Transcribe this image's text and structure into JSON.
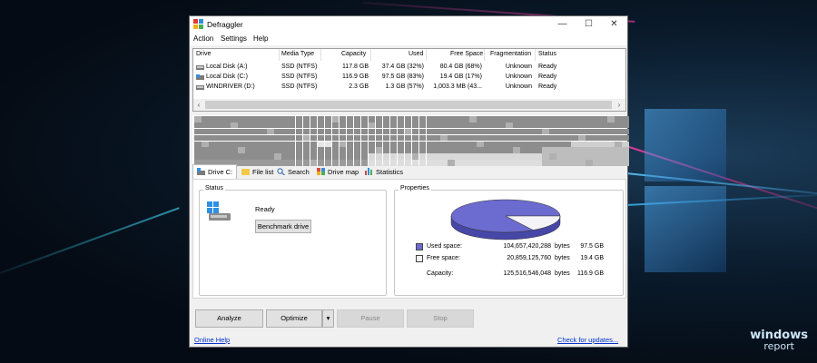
{
  "window": {
    "title": "Defraggler",
    "minimize": "—",
    "maximize": "☐",
    "close": "✕"
  },
  "menu": [
    "Action",
    "Settings",
    "Help"
  ],
  "drive_list": {
    "columns": [
      "Drive",
      "Media Type",
      "Capacity",
      "Used",
      "Free Space",
      "Fragmentation",
      "Status"
    ],
    "rows": [
      {
        "drive": "Local Disk (A:)",
        "media": "SSD (NTFS)",
        "capacity": "117.8 GB",
        "used": "37.4 GB (32%)",
        "free": "80.4 GB (68%)",
        "frag": "Unknown",
        "status": "Ready"
      },
      {
        "drive": "Local Disk (C:)",
        "media": "SSD (NTFS)",
        "capacity": "116.9 GB",
        "used": "97.5 GB (83%)",
        "free": "19.4 GB (17%)",
        "frag": "Unknown",
        "status": "Ready"
      },
      {
        "drive": "WINDRIVER (D:)",
        "media": "SSD (NTFS)",
        "capacity": "2.3 GB",
        "used": "1.3 GB (57%)",
        "free": "1,003.3 MB (43...",
        "frag": "Unknown",
        "status": "Ready"
      }
    ],
    "scroll_left": "‹",
    "scroll_right": "›"
  },
  "tabs": [
    "Drive C:",
    "File list",
    "Search",
    "Drive map",
    "Statistics"
  ],
  "status_group": {
    "title": "Status",
    "state": "Ready",
    "benchmark_button": "Benchmark drive"
  },
  "properties": {
    "title": "Properties",
    "used_label": "Used space:",
    "used_bytes": "104,657,420,288",
    "used_unit": "bytes",
    "used_size": "97.5 GB",
    "free_label": "Free space:",
    "free_bytes": "20,859,125,760",
    "free_unit": "bytes",
    "free_size": "19.4 GB",
    "capacity_label": "Capacity:",
    "capacity_bytes": "125,516,546,048",
    "capacity_unit": "bytes",
    "capacity_size": "116.9 GB",
    "used_fraction": 0.834,
    "used_color": "#6b6bd0",
    "free_color": "#f4f4f8"
  },
  "buttons": {
    "analyze": "Analyze",
    "optimize": "Optimize",
    "optimize_dropdown": "▾",
    "pause": "Pause",
    "stop": "Stop"
  },
  "footer": {
    "online_help": "Online Help",
    "check_updates": "Check for updates..."
  },
  "watermark": {
    "line1": "windows",
    "line2": "report"
  }
}
